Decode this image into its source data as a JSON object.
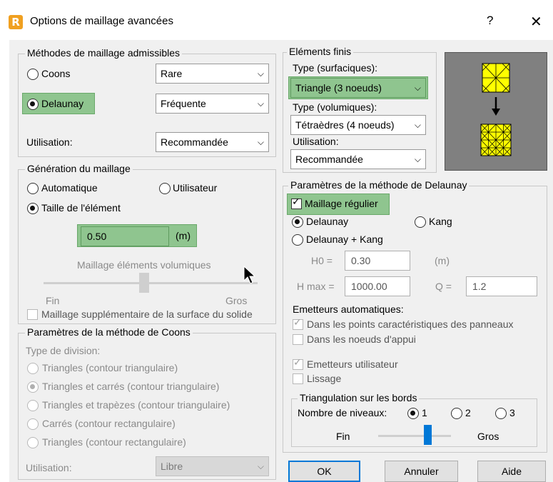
{
  "window": {
    "title": "Options de maillage avancées",
    "app_icon_letter": "R",
    "help_label": "?",
    "close_label": "✕"
  },
  "meshing_methods": {
    "legend": "Méthodes de maillage admissibles",
    "coons_label": "Coons",
    "coons_value": "Rare",
    "delaunay_label": "Delaunay",
    "delaunay_value": "Fréquente",
    "usage_label": "Utilisation:",
    "usage_value": "Recommandée"
  },
  "generation": {
    "legend": "Génération du maillage",
    "auto_label": "Automatique",
    "user_label": "Utilisateur",
    "element_size_label": "Taille de l'élément",
    "element_size_value": "0.50",
    "element_size_unit": "(m)",
    "volume_mesh_label": "Maillage éléments volumiques",
    "slider_min_label": "Fin",
    "slider_max_label": "Gros",
    "solid_surface_label": "Maillage supplémentaire de la surface du solide"
  },
  "coons_params": {
    "legend": "Paramètres de la méthode de Coons",
    "division_type_label": "Type de division:",
    "options": [
      "Triangles (contour triangulaire)",
      "Triangles et carrés (contour triangulaire)",
      "Triangles et trapèzes (contour triangulaire)",
      "Carrés (contour rectangulaire)",
      "Triangles (contour rectangulaire)"
    ],
    "usage_label": "Utilisation:",
    "usage_value": "Libre"
  },
  "finite_elements": {
    "legend": "Eléments finis",
    "surface_type_label": "Type (surfaciques):",
    "surface_type_value": "Triangle (3 noeuds)",
    "volume_type_label": "Type (volumiques):",
    "volume_type_value": "Tétraèdres (4 noeuds)",
    "usage_label": "Utilisation:",
    "usage_value": "Recommandée"
  },
  "delaunay_params": {
    "legend": "Paramètres de la méthode de Delaunay",
    "regular_mesh_label": "Maillage régulier",
    "delaunay_label": "Delaunay",
    "kang_label": "Kang",
    "delaunay_kang_label": "Delaunay + Kang",
    "h0_label": "H0 =",
    "h0_value": "0.30",
    "h0_unit": "(m)",
    "hmax_label": "H max =",
    "hmax_value": "1000.00",
    "q_label": "Q =",
    "q_value": "1.2",
    "auto_emitters_label": "Emetteurs automatiques:",
    "panel_points_label": "Dans les points caractéristiques des panneaux",
    "support_nodes_label": "Dans les noeuds d'appui",
    "user_emitters_label": "Emetteurs utilisateur",
    "smoothing_label": "Lissage"
  },
  "edge_triangulation": {
    "legend": "Triangulation sur les bords",
    "levels_label": "Nombre de niveaux:",
    "level_1": "1",
    "level_2": "2",
    "level_3": "3",
    "slider_min_label": "Fin",
    "slider_max_label": "Gros"
  },
  "buttons": {
    "ok": "OK",
    "cancel": "Annuler",
    "help": "Aide"
  },
  "colors": {
    "highlight": "#8fc58f",
    "accent": "#0078d7",
    "mesh_yellow": "#ffff00"
  }
}
